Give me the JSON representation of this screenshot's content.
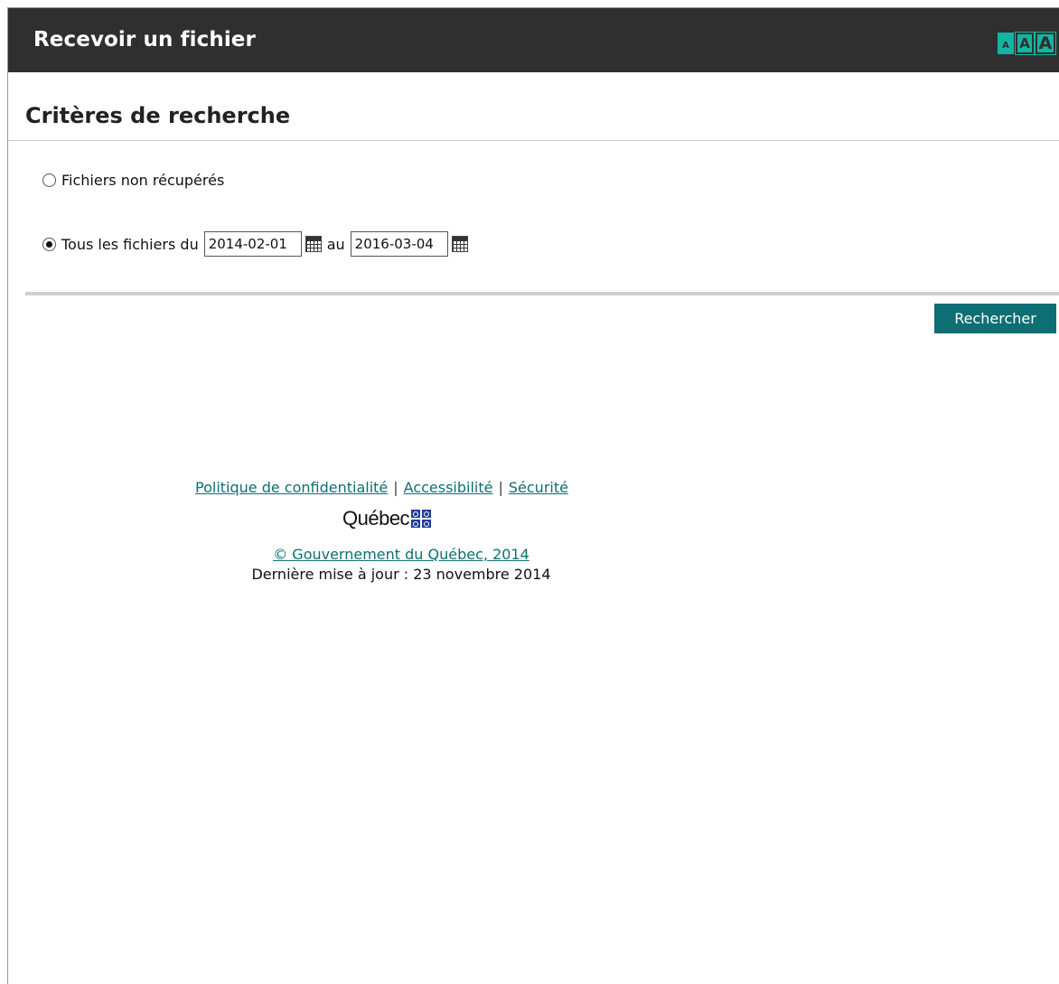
{
  "header": {
    "title": "Recevoir un fichier",
    "font_sizes": {
      "small": "A",
      "medium": "A",
      "large": "A"
    }
  },
  "criteria": {
    "title": "Critères de recherche",
    "option_unretrieved": "Fichiers non récupérés",
    "option_range": "Tous les fichiers du",
    "to_label": "au",
    "date_from": "2014-02-01",
    "date_to": "2016-03-04",
    "selected_option": "range"
  },
  "actions": {
    "search": "Rechercher"
  },
  "footer": {
    "links": {
      "privacy": "Politique de confidentialité",
      "accessibility": "Accessibilité",
      "security": "Sécurité"
    },
    "separator": "|",
    "logo_text": "Québec",
    "copyright": "© Gouvernement du Québec, 2014",
    "last_updated": "Dernière mise à jour : 23 novembre 2014"
  },
  "colors": {
    "header_bg": "#2f2f2f",
    "accent": "#12b5a2",
    "button": "#0d6f73",
    "link": "#0d6f73",
    "flag": "#1f3f99"
  },
  "icons": {
    "calendar": "calendar-icon",
    "flag": "quebec-flag-icon"
  }
}
